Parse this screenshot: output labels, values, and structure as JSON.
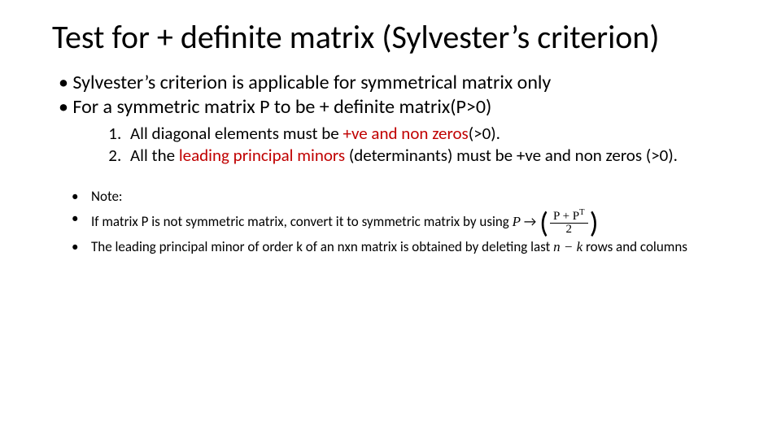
{
  "title": "Test for + definite matrix (Sylvester’s criterion)",
  "bullets": {
    "b1": "Sylvester’s criterion is applicable for symmetrical matrix only",
    "b2": "For a symmetric matrix P to be + definite matrix(P>0)"
  },
  "numbered": {
    "n1_pre": "All diagonal elements must be ",
    "n1_red": "+ve and non zeros",
    "n1_post": "(>0).",
    "n2_pre": "All the ",
    "n2_red": "leading principal minors ",
    "n2_post": "(determinants) must be +ve and non zeros (>0)."
  },
  "notes": {
    "note_label": "Note:",
    "note2_pre": "If matrix P is not symmetric matrix, convert it to symmetric matrix by using ",
    "note2_expr_var": "P",
    "note2_expr_arrow": " → ",
    "frac_num": "P + P",
    "frac_num_sup": "T",
    "frac_den": "2",
    "note3_pre": "The leading principal minor of order k of an nxn matrix is obtained by deleting last ",
    "note3_math": "n − k",
    "note3_post": " rows and columns"
  }
}
